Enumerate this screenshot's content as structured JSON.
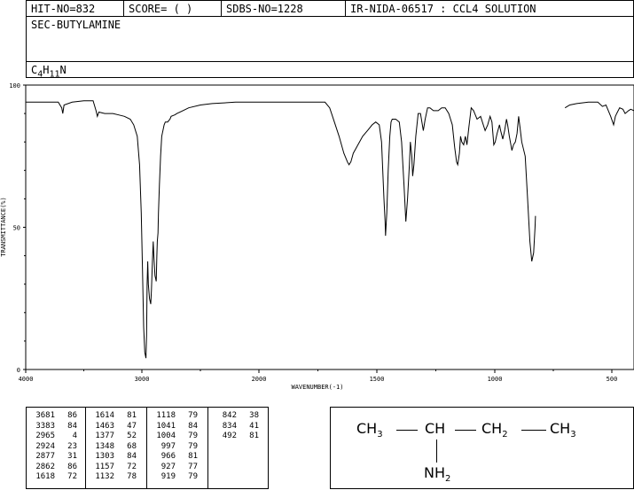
{
  "header": {
    "hit_no": "HIT-NO=832",
    "score": "SCORE=  (   )",
    "sdbs_no": "SDBS-NO=1228",
    "ir_info": "IR-NIDA-06517 : CCL4 SOLUTION"
  },
  "compound_name": "SEC-BUTYLAMINE",
  "formula": {
    "c": "C",
    "c_sub": "4",
    "h": "H",
    "h_sub": "11",
    "n": "N"
  },
  "chart_data": {
    "type": "line",
    "title": "",
    "xlabel": "WAVENUMBER(-1)",
    "ylabel": "TRANSMITTANCE(%)",
    "xlim": [
      4000,
      400
    ],
    "ylim": [
      0,
      100
    ],
    "x_ticks": [
      "4000",
      "3000",
      "2000",
      "1500",
      "1000",
      "500"
    ],
    "y_ticks": [
      "100",
      "50",
      "0"
    ],
    "series": [
      {
        "segments": [
          [
            [
              4000,
              94
            ],
            [
              3800,
              94
            ],
            [
              3720,
              94
            ],
            [
              3690,
              92
            ],
            [
              3681,
              90
            ],
            [
              3670,
              93
            ],
            [
              3600,
              94
            ],
            [
              3500,
              94.5
            ],
            [
              3420,
              94.5
            ],
            [
              3395,
              91
            ],
            [
              3383,
              89
            ],
            [
              3370,
              90.5
            ],
            [
              3320,
              90
            ],
            [
              3250,
              90
            ],
            [
              3200,
              89.5
            ],
            [
              3150,
              89
            ],
            [
              3100,
              88
            ],
            [
              3070,
              86
            ],
            [
              3040,
              82
            ],
            [
              3020,
              72
            ],
            [
              3005,
              55
            ],
            [
              2995,
              35
            ],
            [
              2985,
              15
            ],
            [
              2975,
              6
            ],
            [
              2965,
              4
            ],
            [
              2960,
              12
            ],
            [
              2955,
              30
            ],
            [
              2950,
              38
            ],
            [
              2945,
              30
            ],
            [
              2935,
              25
            ],
            [
              2924,
              23
            ],
            [
              2918,
              28
            ],
            [
              2910,
              38
            ],
            [
              2903,
              45
            ],
            [
              2898,
              40
            ],
            [
              2888,
              33
            ],
            [
              2877,
              31
            ],
            [
              2872,
              40
            ],
            [
              2868,
              45
            ],
            [
              2862,
              48
            ],
            [
              2858,
              55
            ],
            [
              2850,
              65
            ],
            [
              2840,
              75
            ],
            [
              2830,
              82
            ],
            [
              2810,
              86
            ],
            [
              2800,
              87
            ],
            [
              2780,
              87
            ],
            [
              2760,
              88
            ],
            [
              2750,
              89
            ],
            [
              2720,
              89.5
            ],
            [
              2700,
              90
            ],
            [
              2650,
              91
            ],
            [
              2600,
              92
            ],
            [
              2500,
              93
            ],
            [
              2400,
              93.5
            ],
            [
              2200,
              94
            ],
            [
              2000,
              94
            ],
            [
              1800,
              94
            ],
            [
              1720,
              94
            ],
            [
              1700,
              92
            ],
            [
              1680,
              87
            ],
            [
              1660,
              82
            ],
            [
              1640,
              76
            ],
            [
              1625,
              73
            ],
            [
              1618,
              72
            ],
            [
              1610,
              73
            ],
            [
              1600,
              76
            ],
            [
              1580,
              79
            ],
            [
              1560,
              82
            ],
            [
              1540,
              84
            ],
            [
              1520,
              86
            ],
            [
              1505,
              87
            ],
            [
              1490,
              86
            ],
            [
              1480,
              80
            ],
            [
              1470,
              60
            ],
            [
              1465,
              52
            ],
            [
              1463,
              47
            ],
            [
              1458,
              55
            ],
            [
              1452,
              70
            ],
            [
              1445,
              82
            ],
            [
              1440,
              87
            ],
            [
              1435,
              88
            ],
            [
              1420,
              88
            ],
            [
              1405,
              87
            ],
            [
              1395,
              80
            ],
            [
              1385,
              65
            ],
            [
              1377,
              52
            ],
            [
              1370,
              60
            ],
            [
              1362,
              72
            ],
            [
              1358,
              80
            ],
            [
              1352,
              75
            ],
            [
              1348,
              68
            ],
            [
              1343,
              72
            ],
            [
              1335,
              82
            ],
            [
              1325,
              90
            ],
            [
              1315,
              90
            ],
            [
              1303,
              84
            ],
            [
              1295,
              88
            ],
            [
              1285,
              92
            ],
            [
              1275,
              92
            ],
            [
              1260,
              91
            ],
            [
              1240,
              91
            ],
            [
              1225,
              92
            ],
            [
              1210,
              92
            ],
            [
              1195,
              90
            ],
            [
              1180,
              86
            ],
            [
              1170,
              78
            ],
            [
              1162,
              73
            ],
            [
              1157,
              72
            ],
            [
              1150,
              76
            ],
            [
              1145,
              82
            ],
            [
              1140,
              80
            ],
            [
              1132,
              79
            ],
            [
              1125,
              82
            ],
            [
              1118,
              79
            ],
            [
              1110,
              85
            ],
            [
              1100,
              92
            ],
            [
              1090,
              91
            ],
            [
              1075,
              88
            ],
            [
              1060,
              89
            ],
            [
              1041,
              84
            ],
            [
              1030,
              86
            ],
            [
              1020,
              89
            ],
            [
              1012,
              87
            ],
            [
              1004,
              79
            ],
            [
              998,
              80
            ],
            [
              990,
              83
            ],
            [
              980,
              86
            ],
            [
              975,
              84
            ],
            [
              966,
              81
            ],
            [
              958,
              84
            ],
            [
              950,
              88
            ],
            [
              945,
              86
            ],
            [
              938,
              82
            ],
            [
              927,
              77
            ],
            [
              920,
              79
            ],
            [
              912,
              80
            ],
            [
              905,
              83
            ],
            [
              898,
              89
            ],
            [
              892,
              85
            ],
            [
              885,
              80
            ],
            [
              870,
              75
            ],
            [
              860,
              60
            ],
            [
              850,
              45
            ],
            [
              842,
              38
            ],
            [
              834,
              41
            ],
            [
              828,
              50
            ],
            [
              826,
              54
            ]
          ],
          [
            [
              700,
              92
            ],
            [
              680,
              93
            ],
            [
              650,
              93.5
            ],
            [
              600,
              94
            ],
            [
              560,
              94
            ],
            [
              540,
              92.5
            ],
            [
              525,
              93
            ],
            [
              505,
              89
            ],
            [
              492,
              86
            ],
            [
              484,
              89
            ],
            [
              478,
              90
            ],
            [
              465,
              92
            ],
            [
              450,
              91.5
            ],
            [
              440,
              90
            ],
            [
              425,
              91
            ],
            [
              415,
              91.5
            ],
            [
              400,
              91
            ]
          ]
        ]
      }
    ]
  },
  "peak_table": {
    "col1": [
      [
        "3681",
        "86"
      ],
      [
        "3383",
        "84"
      ],
      [
        "2965",
        "4"
      ],
      [
        "2924",
        "23"
      ],
      [
        "2877",
        "31"
      ],
      [
        "2862",
        "86"
      ],
      [
        "1618",
        "72"
      ]
    ],
    "col2": [
      [
        "1614",
        "81"
      ],
      [
        "1463",
        "47"
      ],
      [
        "1377",
        "52"
      ],
      [
        "1348",
        "68"
      ],
      [
        "1303",
        "84"
      ],
      [
        "1157",
        "72"
      ],
      [
        "1132",
        "78"
      ]
    ],
    "col3": [
      [
        "1118",
        "79"
      ],
      [
        "1041",
        "84"
      ],
      [
        "1004",
        "79"
      ],
      [
        "997",
        "79"
      ],
      [
        "966",
        "81"
      ],
      [
        "927",
        "77"
      ],
      [
        "919",
        "79"
      ]
    ],
    "col4": [
      [
        "842",
        "38"
      ],
      [
        "834",
        "41"
      ],
      [
        "492",
        "81"
      ]
    ]
  },
  "structure": {
    "ch3_left_main": "CH",
    "ch3_left_sub": "3",
    "ch": "CH",
    "ch2_main": "CH",
    "ch2_sub": "2",
    "ch3_right_main": "CH",
    "ch3_right_sub": "3",
    "nh2_main": "NH",
    "nh2_sub": "2"
  }
}
